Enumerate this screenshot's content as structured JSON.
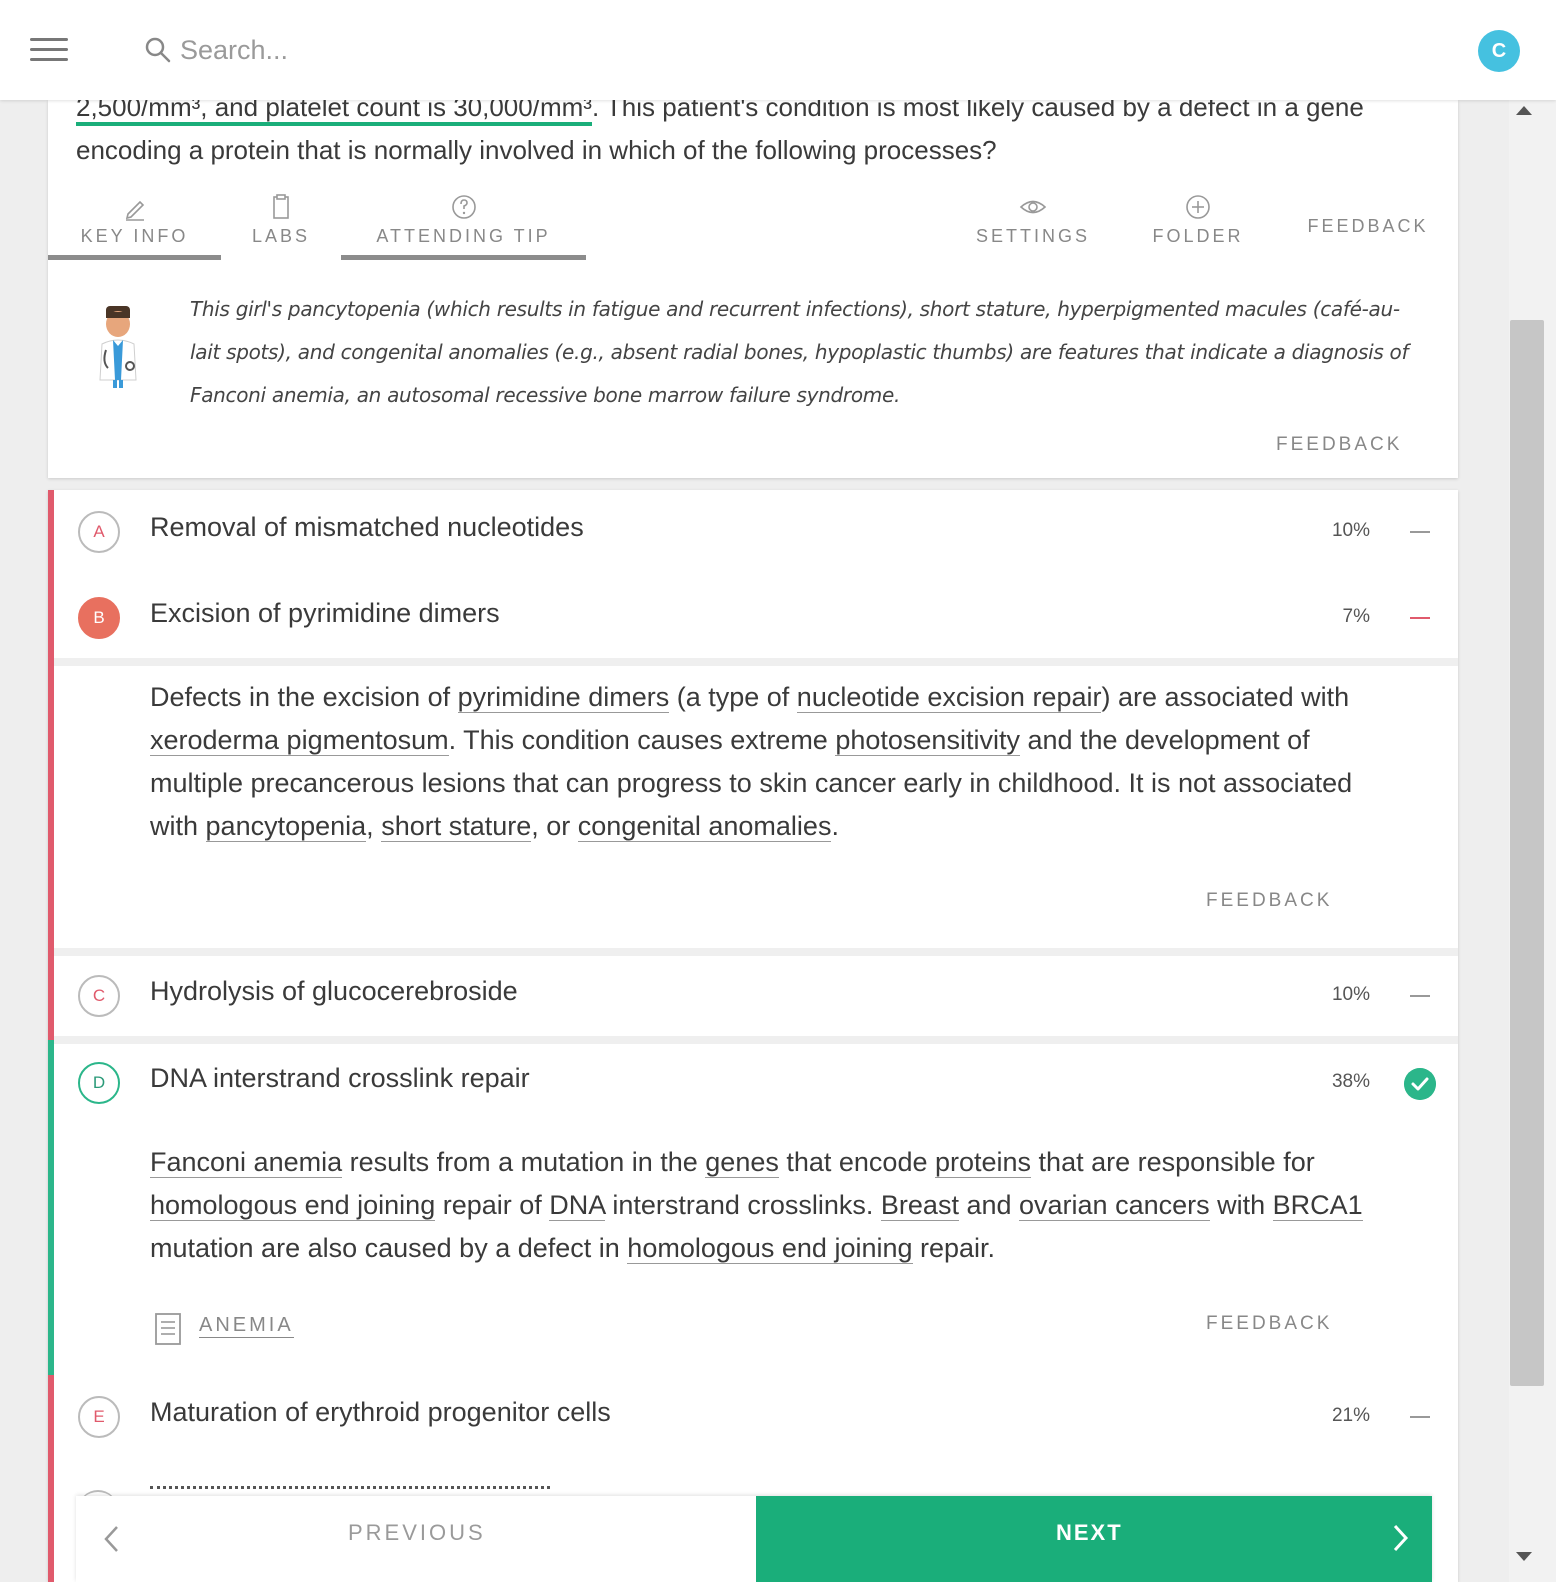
{
  "header": {
    "search_placeholder": "Search...",
    "avatar_initial": "C"
  },
  "question": {
    "stem_highlight": "2,500/mm³, and platelet count is 30,000/mm³",
    "stem_rest": ". This patient's condition is most likely caused by a defect in a gene encoding a protein that is normally involved in which of the following processes?"
  },
  "toolbar": {
    "key_info": "KEY INFO",
    "labs": "LABS",
    "attending_tip": "ATTENDING TIP",
    "settings": "SETTINGS",
    "folder": "FOLDER",
    "feedback": "FEEDBACK"
  },
  "attending_tip": {
    "text": "This girl's pancytopenia (which results in fatigue and recurrent infections), short stature, hyperpigmented macules (café-au-lait spots), and congenital anomalies (e.g., absent radial bones, hypoplastic thumbs) are features that indicate a diagnosis of Fanconi anemia, an autosomal recessive bone marrow failure syndrome.",
    "feedback": "FEEDBACK"
  },
  "choices": [
    {
      "letter": "A",
      "text": "Removal of mismatched nucleotides",
      "percent": "10%"
    },
    {
      "letter": "B",
      "text": "Excision of pyrimidine dimers",
      "percent": "7%"
    },
    {
      "letter": "C",
      "text": "Hydrolysis of glucocerebroside",
      "percent": "10%"
    },
    {
      "letter": "D",
      "text": "DNA interstrand crosslink repair",
      "percent": "38%"
    },
    {
      "letter": "E",
      "text": "Maturation of erythroid progenitor cells",
      "percent": "21%"
    }
  ],
  "explanation_b": {
    "p1": "Defects in the excision of ",
    "u1": "pyrimidine dimers",
    "p2": " (a type of ",
    "u2": "nucleotide excision repair",
    "p3": ") are associated with ",
    "u3": "xeroderma pigmentosum",
    "p4": ". This condition causes extreme ",
    "u4": "photosensitivity",
    "p5": " and the development of multiple precancerous lesions that can progress to skin cancer early in childhood. It is not associated with ",
    "u5": "pancytopenia",
    "p6": ", ",
    "u6": "short stature",
    "p7": ", or ",
    "u7": "congenital anomalies",
    "p8": ".",
    "feedback": "FEEDBACK"
  },
  "explanation_d": {
    "u1": "Fanconi anemia",
    "p1": " results from a mutation in the ",
    "u2": "genes",
    "p2": " that encode ",
    "u3": "proteins",
    "p3": " that are responsible for ",
    "u4": "homologous end joining",
    "p4": " repair of ",
    "u5": "DNA",
    "p5": " interstrand crosslinks. ",
    "u6": "Breast",
    "p6": " and ",
    "u7": "ovarian cancers",
    "p7": " with ",
    "u8": "BRCA1",
    "p8": " mutation are also caused by a defect in ",
    "u9": "homologous end joining",
    "p9": " repair.",
    "link": "ANEMIA",
    "feedback": "FEEDBACK"
  },
  "nav": {
    "previous": "PREVIOUS",
    "next": "NEXT"
  },
  "colors": {
    "accent_green": "#1aae7a",
    "incorrect_red": "#e05a6c",
    "avatar_blue": "#45c1e0"
  },
  "icons": [
    "menu-icon",
    "search-icon",
    "pencil-icon",
    "clipboard-icon",
    "question-circle-icon",
    "eye-icon",
    "plus-circle-icon",
    "doctor-icon",
    "check-circle-icon",
    "document-icon",
    "chevron-left-icon",
    "chevron-right-icon"
  ]
}
